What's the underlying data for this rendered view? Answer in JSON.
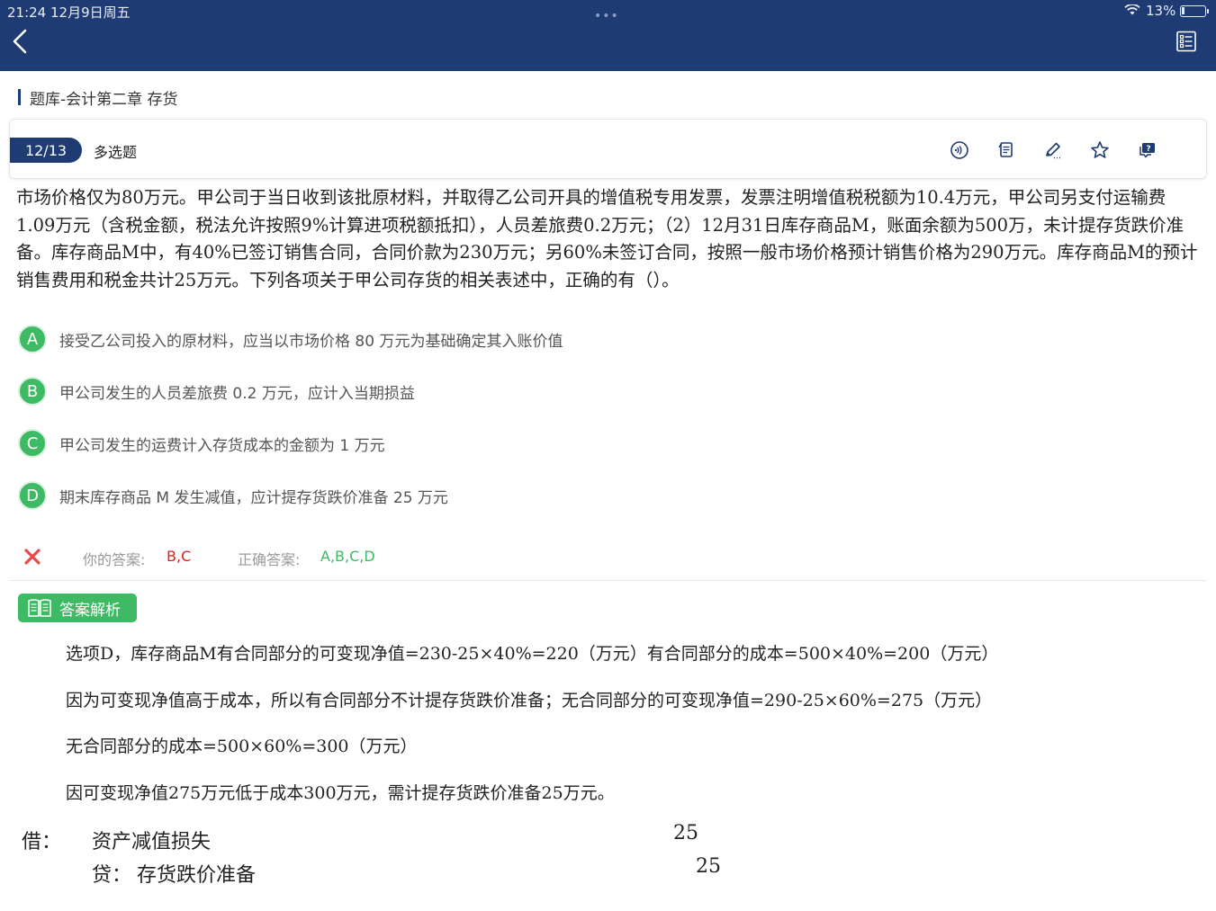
{
  "status_bar": {
    "time": "21:24   12月9日周五",
    "grabber": "•••",
    "battery": "13%",
    "battery_level": 0.13
  },
  "header": {
    "back_icon": "chevron-left-icon",
    "menu_icon": "list-icon",
    "color": "#1f3b73"
  },
  "breadcrumb": "题库-会计第二章 存货",
  "question_header": {
    "counter": "12/13",
    "type": "多选题",
    "tools": [
      "audio-icon",
      "notes-icon",
      "pencil-icon",
      "star-icon",
      "help-icon"
    ]
  },
  "question": {
    "text": "市场价格仅为80万元。甲公司于当日收到该批原材料，并取得乙公司开具的增值税专用发票，发票注明增值税税额为10.4万元，甲公司另支付运输费1.09万元（含税金额，税法允许按照9%计算进项税额抵扣），人员差旅费0.2万元；（2）12月31日库存商品M，账面余额为500万，未计提存货跌价准备。库存商品M中，有40%已签订销售合同，合同价款为230万元；另60%未签订合同，按照一般市场价格预计销售价格为290万元。库存商品M的预计销售费用和税金共计25万元。下列各项关于甲公司存货的相关表述中，正确的有（）。"
  },
  "options": [
    {
      "letter": "A",
      "text": "接受乙公司投入的原材料，应当以市场价格 80 万元为基础确定其入账价值"
    },
    {
      "letter": "B",
      "text": "甲公司发生的人员差旅费 0.2 万元，应计入当期损益"
    },
    {
      "letter": "C",
      "text": "甲公司发生的运费计入存货成本的金额为 1 万元"
    },
    {
      "letter": "D",
      "text": "期末库存商品 M 发生减值，应计提存货跌价准备 25 万元"
    }
  ],
  "answer": {
    "your_label": "你的答案:",
    "your_value": "B,C",
    "correct_label": "正确答案:",
    "correct_value": "A,B,C,D",
    "accent_green": "#3fba64",
    "accent_red": "#e02020"
  },
  "analysis": {
    "title": "答案解析",
    "lines": [
      "选项D，库存商品M有合同部分的可变现净值=230-25×40%=220（万元）有合同部分的成本=500×40%=200（万元）",
      "因为可变现净值高于成本，所以有合同部分不计提存货跌价准备；无合同部分的可变现净值=290-25×60%=275（万元）",
      "无合同部分的成本=500×60%=300（万元）",
      "因可变现净值275万元低于成本300万元，需计提存货跌价准备25万元。"
    ],
    "journal": {
      "debit_label": "借：",
      "debit_account": "资产减值损失",
      "debit_amount": "25",
      "credit_label": "贷：",
      "credit_account": "存货跌价准备",
      "credit_amount": "25"
    }
  }
}
